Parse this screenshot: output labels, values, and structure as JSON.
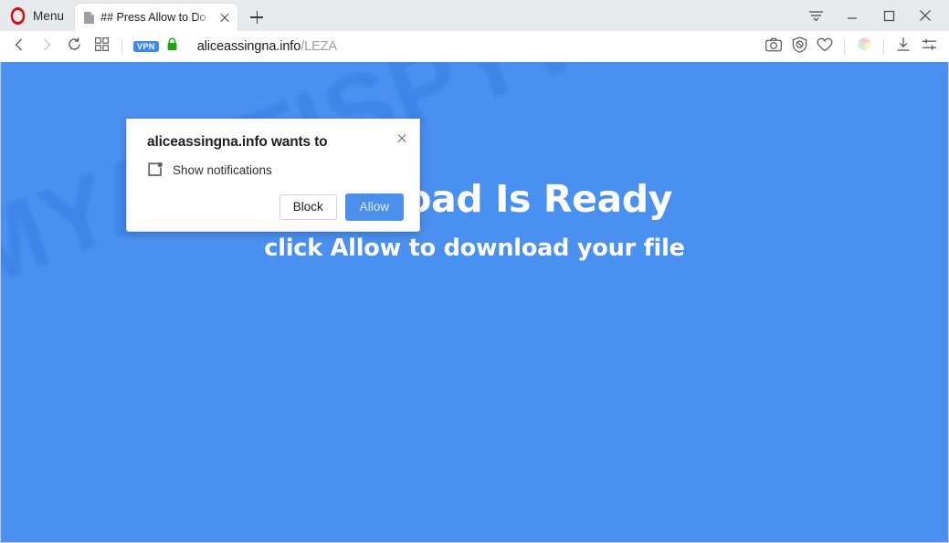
{
  "browser": {
    "menu_label": "Menu",
    "opera_logo_icon": "opera-logo-icon",
    "tab": {
      "title": "## Press Allow to Do",
      "favicon_icon": "page-favicon-icon",
      "close_icon": "close-icon"
    },
    "new_tab_icon": "plus-icon",
    "window_controls": [
      {
        "name": "tab-menu-button",
        "icon": "tab-list-icon"
      },
      {
        "name": "minimize-button",
        "icon": "minimize-icon"
      },
      {
        "name": "maximize-button",
        "icon": "maximize-icon"
      },
      {
        "name": "close-window-button",
        "icon": "close-icon"
      }
    ]
  },
  "toolbar": {
    "back_icon": "chevron-left-icon",
    "forward_icon": "chevron-right-icon",
    "reload_icon": "reload-icon",
    "speeddial_icon": "grid-squares-icon",
    "vpn_badge": "VPN",
    "lock_icon": "padlock-icon",
    "url_domain": "aliceassingna.info",
    "url_path": "/LEZA",
    "right_icons": [
      {
        "name": "snapshot-button",
        "icon": "camera-icon"
      },
      {
        "name": "ad-blocker-button",
        "icon": "shield-block-icon"
      },
      {
        "name": "favorites-button",
        "icon": "heart-icon"
      },
      {
        "name": "extensions-button",
        "icon": "cube-icon"
      },
      {
        "name": "downloads-button",
        "icon": "download-icon"
      },
      {
        "name": "easy-setup-button",
        "icon": "sliders-icon"
      }
    ]
  },
  "dialog": {
    "title": "aliceassingna.info wants to",
    "permission_label": "Show notifications",
    "permission_icon": "notification-box-icon",
    "close_icon": "close-icon",
    "block_label": "Block",
    "allow_label": "Allow"
  },
  "page": {
    "heading": "Download Is Ready",
    "subheading": "click Allow to download your file",
    "watermark": "MYANTISPYWARE.COM",
    "background_color": "#4a90f0",
    "watermark_color": "#3f86ea",
    "text_color": "#ffffff"
  }
}
